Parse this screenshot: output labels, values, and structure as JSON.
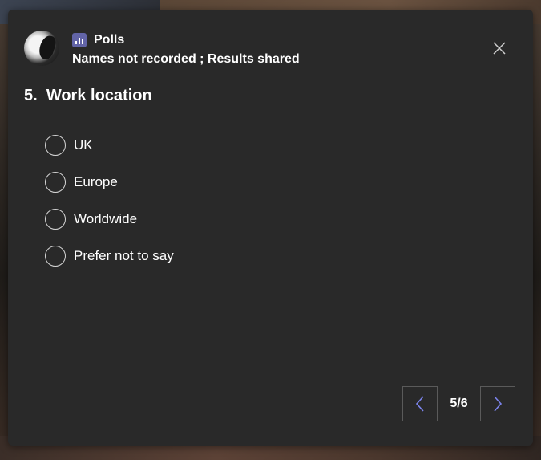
{
  "poll": {
    "app_name": "Polls",
    "subtitle": "Names not recorded ; Results shared",
    "question_number": "5.",
    "question_text": "Work location",
    "options": [
      "UK",
      "Europe",
      "Worldwide",
      "Prefer not to say"
    ],
    "page_indicator": "5/6"
  },
  "colors": {
    "card_bg": "#292929",
    "accent": "#6264a7",
    "text": "#ffffff"
  },
  "icons": {
    "app": "bar-chart-icon",
    "close": "close-icon",
    "prev": "chevron-left-icon",
    "next": "chevron-right-icon"
  }
}
